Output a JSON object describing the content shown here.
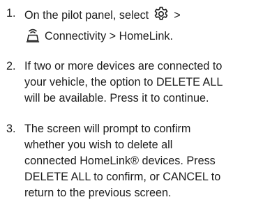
{
  "steps": [
    {
      "number": "1.",
      "line1_prefix": "On the pilot panel, select",
      "line1_suffix": ">",
      "line2": "Connectivity > HomeLink.",
      "icons": [
        "gear-icon",
        "connectivity-icon"
      ]
    },
    {
      "number": "2.",
      "lines": [
        "If two or more devices are connected to",
        "your vehicle, the option to DELETE ALL",
        "will be available. Press it to continue."
      ]
    },
    {
      "number": "3.",
      "lines": [
        "The screen will prompt to confirm",
        "whether you wish to delete all",
        "connected HomeLink® devices. Press",
        "DELETE ALL to confirm, or CANCEL to",
        "return to the previous screen."
      ]
    }
  ]
}
